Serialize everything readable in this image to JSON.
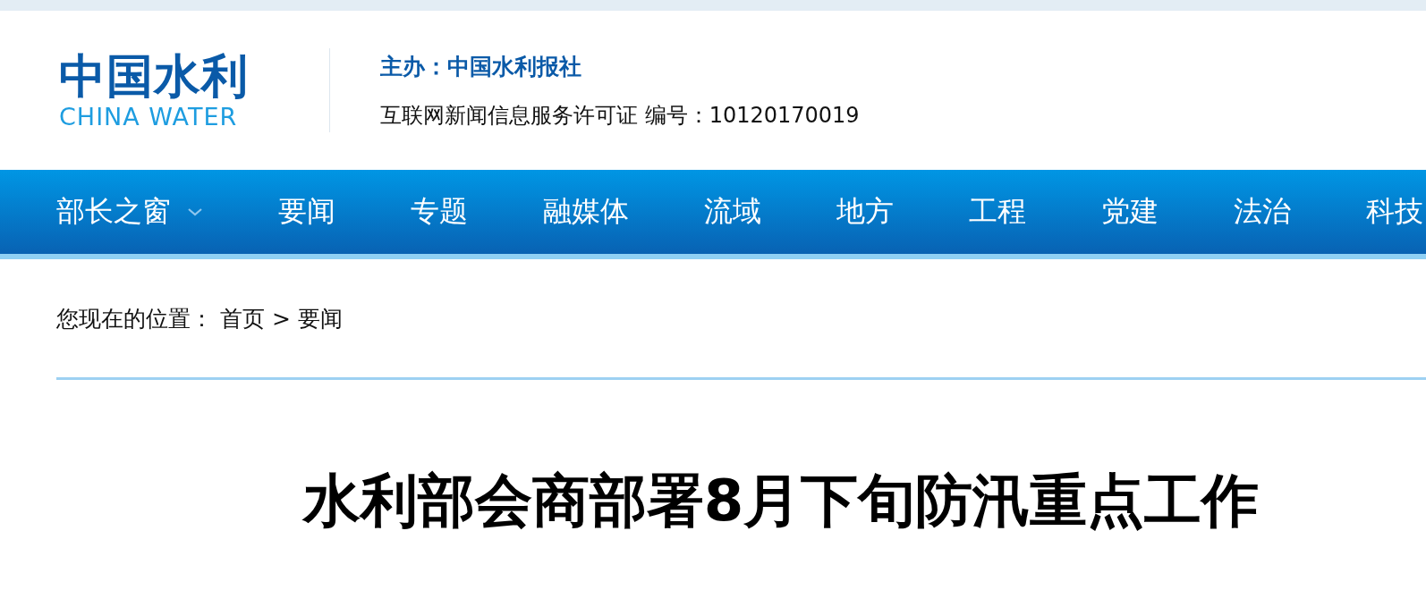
{
  "logo": {
    "chinese": "中国水利",
    "english": "CHINA WATER"
  },
  "header": {
    "sponsor": "主办：中国水利报社",
    "license": "互联网新闻信息服务许可证 编号：10120170019"
  },
  "nav": [
    {
      "label": "部长之窗",
      "has_dropdown": true
    },
    {
      "label": "要闻",
      "has_dropdown": false
    },
    {
      "label": "专题",
      "has_dropdown": false
    },
    {
      "label": "融媒体",
      "has_dropdown": false
    },
    {
      "label": "流域",
      "has_dropdown": false
    },
    {
      "label": "地方",
      "has_dropdown": false
    },
    {
      "label": "工程",
      "has_dropdown": false
    },
    {
      "label": "党建",
      "has_dropdown": false
    },
    {
      "label": "法治",
      "has_dropdown": false
    },
    {
      "label": "科技",
      "has_dropdown": false
    }
  ],
  "breadcrumb": {
    "prefix": "您现在的位置：",
    "items": [
      "首页",
      "要闻"
    ],
    "separator": ">"
  },
  "article": {
    "title": "水利部会商部署8月下旬防汛重点工作"
  }
}
